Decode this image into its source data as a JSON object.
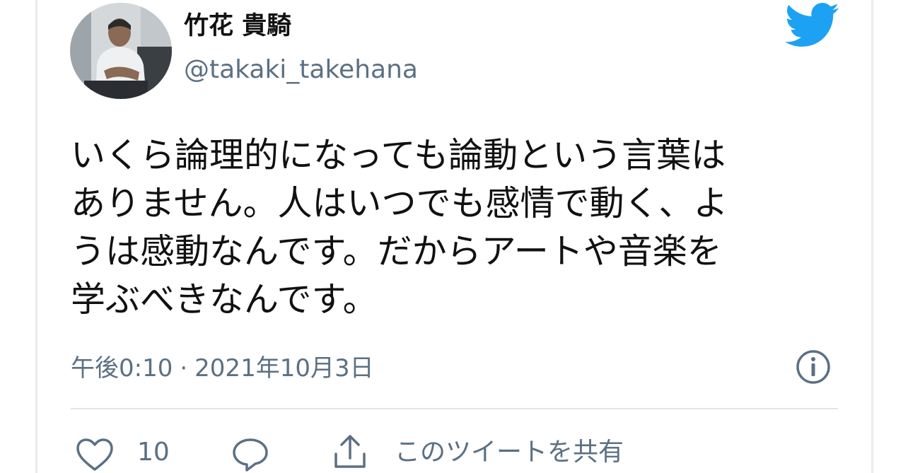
{
  "user": {
    "display_name": "竹花 貴騎",
    "handle": "@takaki_takehana"
  },
  "tweet": {
    "lines": [
      "いくら論理的になっても論動という言葉は",
      "ありません。人はいつでも感情で動く、よ",
      "うは感動なんです。だからアートや音楽を",
      "学ぶべきなんです。"
    ],
    "time": "午後0:10",
    "separator": "·",
    "date": "2021年10月3日"
  },
  "actions": {
    "like_count": "10",
    "share_label": "このツイートを共有"
  },
  "icons": {
    "brand": "twitter-bird-icon",
    "info": "info-icon",
    "like": "heart-icon",
    "reply": "reply-icon",
    "share": "share-icon"
  },
  "colors": {
    "brand": "#1da1f2",
    "text": "#111111",
    "secondary": "#5b7083",
    "divider": "#dfe5ea"
  }
}
